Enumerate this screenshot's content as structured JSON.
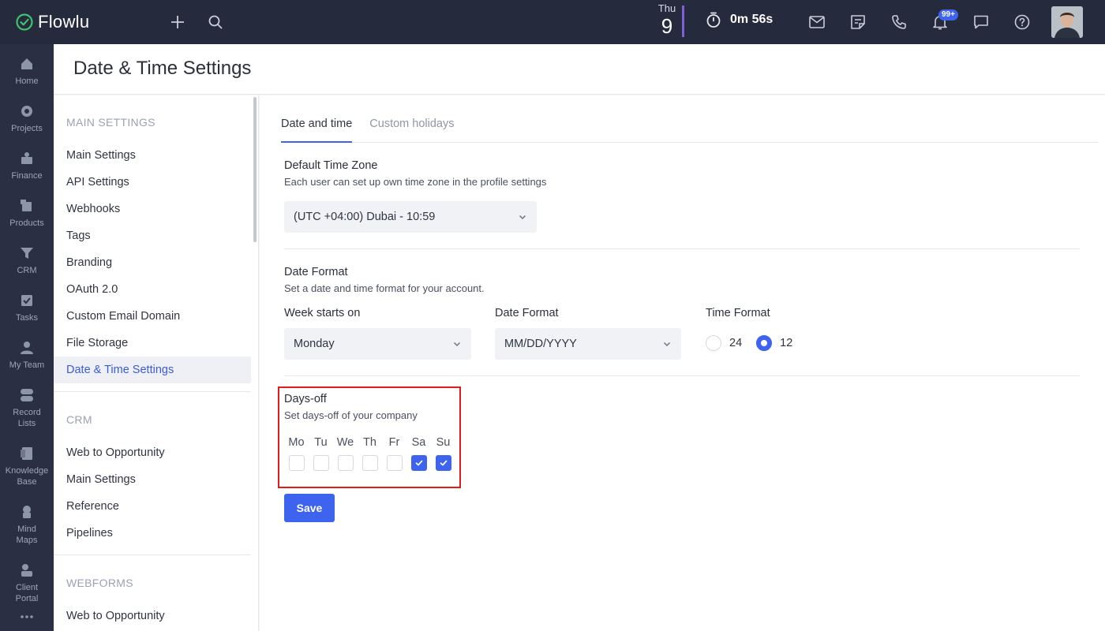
{
  "app": {
    "name": "Flowlu"
  },
  "topbar": {
    "date_day": "Thu",
    "date_num": "9",
    "timer": "0m 56s",
    "notifications_badge": "99+"
  },
  "nav": [
    {
      "label": "Home",
      "icon": "home-icon"
    },
    {
      "label": "Projects",
      "icon": "projects-icon"
    },
    {
      "label": "Finance",
      "icon": "finance-icon"
    },
    {
      "label": "Products",
      "icon": "products-icon"
    },
    {
      "label": "CRM",
      "icon": "crm-funnel-icon"
    },
    {
      "label": "Tasks",
      "icon": "tasks-icon"
    },
    {
      "label": "My Team",
      "icon": "team-icon"
    },
    {
      "label": "Record\nLists",
      "icon": "record-lists-icon"
    },
    {
      "label": "Knowledge\nBase",
      "icon": "knowledge-base-icon"
    },
    {
      "label": "Mind\nMaps",
      "icon": "mind-maps-icon"
    },
    {
      "label": "Client\nPortal",
      "icon": "client-portal-icon"
    }
  ],
  "page": {
    "title": "Date & Time Settings"
  },
  "sidebar": {
    "main_settings_title": "MAIN SETTINGS",
    "main_items": [
      "Main Settings",
      "API Settings",
      "Webhooks",
      "Tags",
      "Branding",
      "OAuth 2.0",
      "Custom Email Domain",
      "File Storage",
      "Date & Time Settings"
    ],
    "crm_title": "CRM",
    "crm_items": [
      "Web to Opportunity",
      "Main Settings",
      "Reference",
      "Pipelines"
    ],
    "webforms_title": "WEBFORMS",
    "webforms_items": [
      "Web to Opportunity"
    ]
  },
  "tabs": [
    "Date and time",
    "Custom holidays"
  ],
  "timezone": {
    "title": "Default Time Zone",
    "subtitle": "Each user can set up own time zone in the profile settings",
    "value": "(UTC +04:00) Dubai - 10:59"
  },
  "date_format": {
    "title": "Date Format",
    "subtitle": "Set a date and time format for your account.",
    "week_label": "Week starts on",
    "week_value": "Monday",
    "format_label": "Date Format",
    "format_value": "MM/DD/YYYY",
    "time_label": "Time Format",
    "time_options": [
      "24",
      "12"
    ],
    "time_selected": "12"
  },
  "days_off": {
    "title": "Days-off",
    "subtitle": "Set days-off of your company",
    "days": [
      {
        "label": "Mo",
        "checked": false
      },
      {
        "label": "Tu",
        "checked": false
      },
      {
        "label": "We",
        "checked": false
      },
      {
        "label": "Th",
        "checked": false
      },
      {
        "label": "Fr",
        "checked": false
      },
      {
        "label": "Sa",
        "checked": true
      },
      {
        "label": "Su",
        "checked": true
      }
    ]
  },
  "save_label": "Save",
  "colors": {
    "accent": "#3e63ee",
    "topbar": "#252a3d",
    "leftnav": "#2a2f43",
    "highlight": "#e21b1b"
  }
}
